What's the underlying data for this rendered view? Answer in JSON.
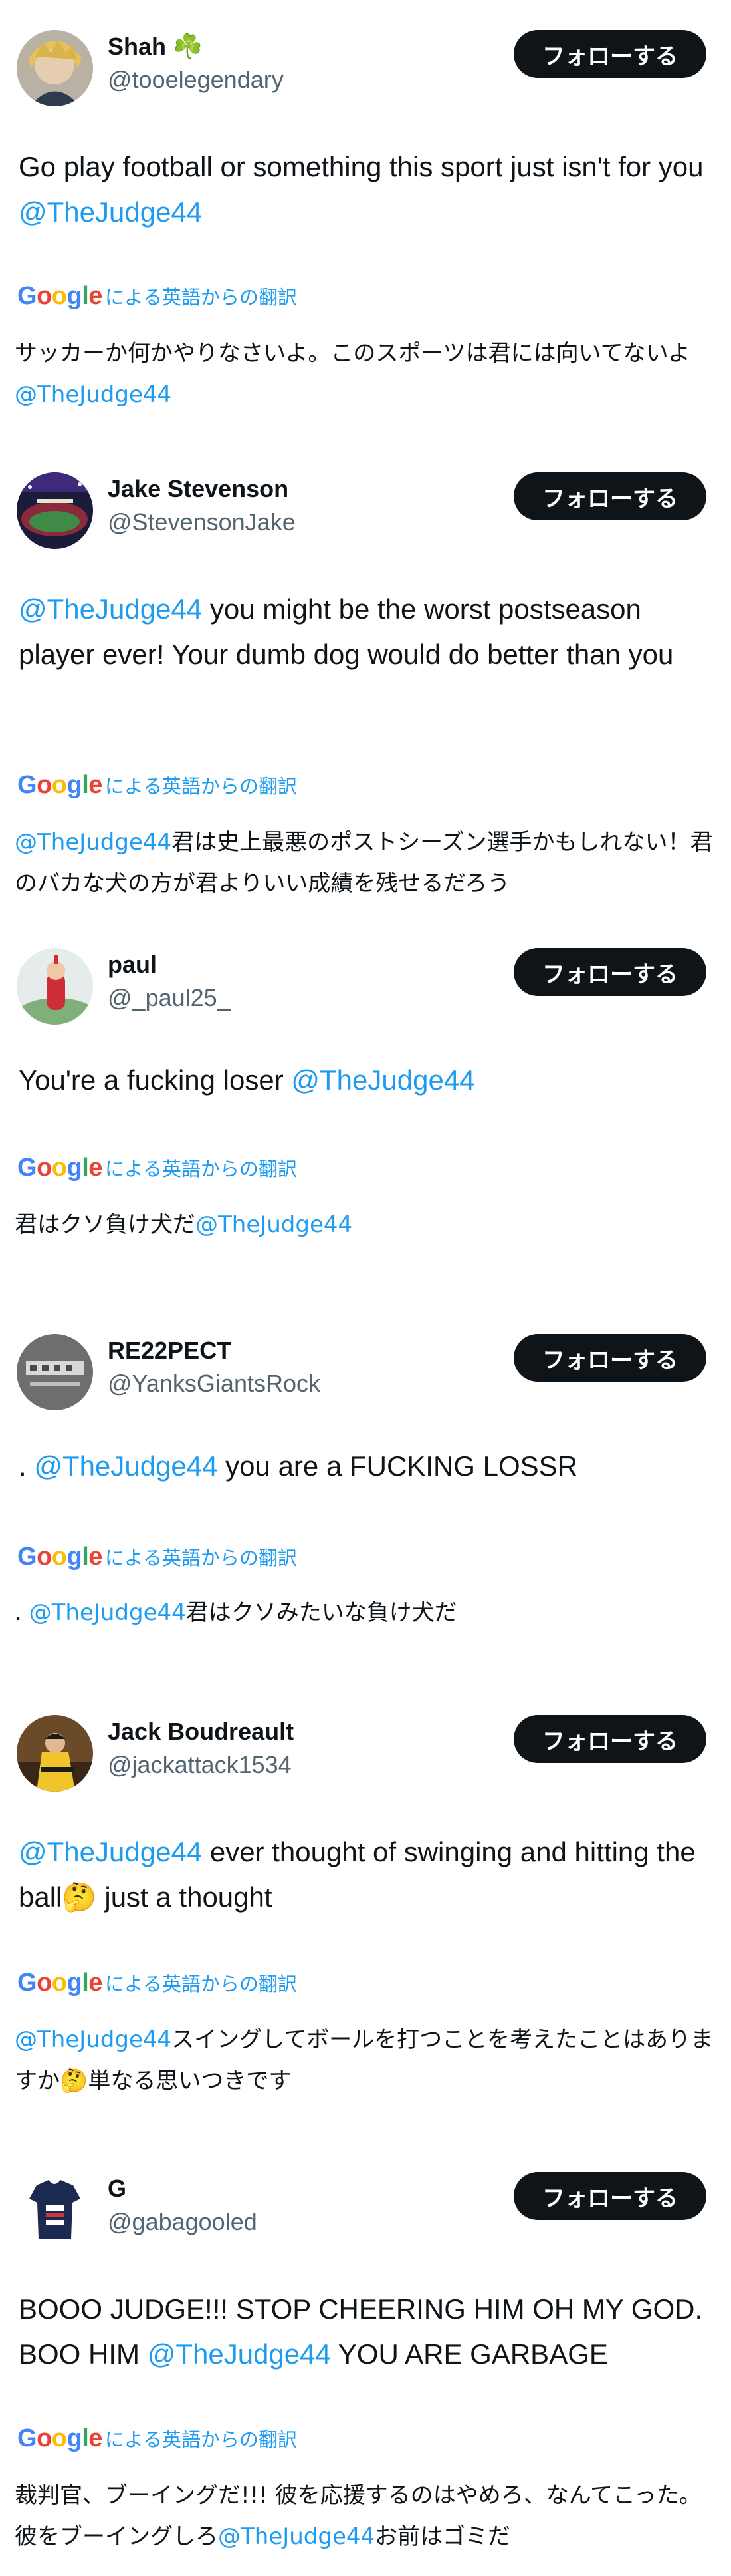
{
  "follow_label": "フォローする",
  "translation_label": "による英語からの翻訳",
  "google_logo": "Google",
  "colors": {
    "follow_bg": "#0f1419",
    "mention": "#1d9bf0",
    "handle": "#536471"
  },
  "tweets": [
    {
      "name": "Shah",
      "name_emoji": "☘️",
      "handle": "@tooelegendary",
      "text": [
        "Go play football or something this sport just isn't for you ",
        "@TheJudge44"
      ],
      "translation": [
        "サッカーか何かやりなさいよ。このスポーツは君には向いてないよ",
        "@TheJudge44"
      ]
    },
    {
      "name": "Jake Stevenson",
      "handle": "@StevensonJake",
      "text": [
        "@TheJudge44",
        " you might be the worst postseason player ever! Your dumb dog would do better than you"
      ],
      "translation": [
        "@TheJudge44",
        "君は史上最悪のポストシーズン選手かもしれない！君のバカな犬の方が君よりいい成績を残せるだろう"
      ]
    },
    {
      "name": "paul",
      "handle": "@_paul25_",
      "text": [
        "You're a fucking loser ",
        "@TheJudge44"
      ],
      "translation": [
        "君はクソ負け犬だ",
        "@TheJudge44"
      ]
    },
    {
      "name": "RE22PECT",
      "handle": "@YanksGiantsRock",
      "text": [
        ". ",
        "@TheJudge44",
        " you are a FUCKING LOSSR"
      ],
      "translation": [
        ". ",
        "@TheJudge44",
        "君はクソみたいな負け犬だ"
      ]
    },
    {
      "name": "Jack Boudreault",
      "handle": "@jackattack1534",
      "text": [
        "@TheJudge44",
        " ever thought of swinging and hitting the ball",
        "🤔",
        " just a thought"
      ],
      "translation": [
        "@TheJudge44",
        "スイングしてボールを打つことを考えたことはありますか",
        "🤔",
        "単なる思いつきです"
      ]
    },
    {
      "name": "G",
      "handle": "@gabagooled",
      "text": [
        "BOOO JUDGE!!! STOP CHEERING HIM OH MY GOD. BOO HIM ",
        "@TheJudge44",
        " YOU ARE GARBAGE"
      ],
      "translation": [
        "裁判官、ブーイングだ!!! 彼を応援するのはやめろ、なんてこった。彼をブーイングしろ",
        "@TheJudge44",
        "お前はゴミだ"
      ]
    }
  ]
}
